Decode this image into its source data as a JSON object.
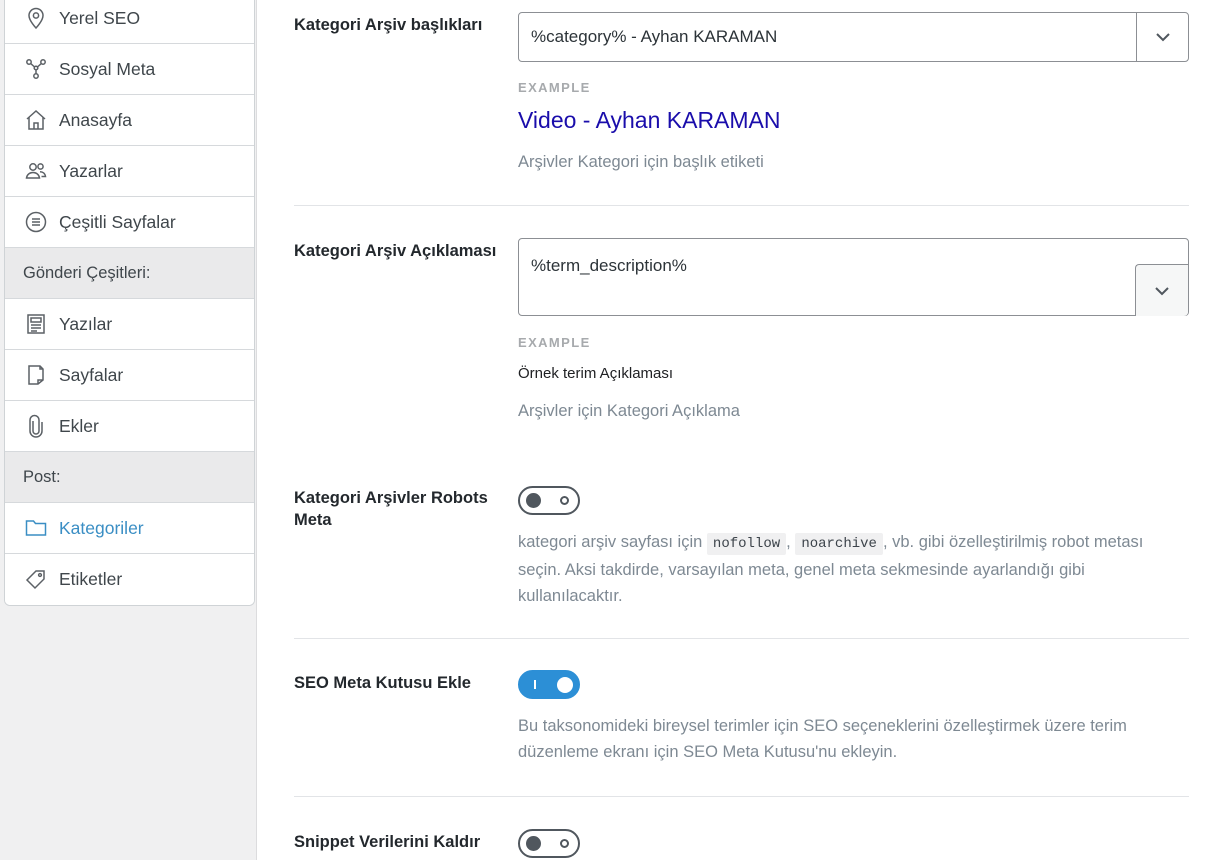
{
  "sidebar": {
    "items": [
      {
        "label": "Yerel SEO",
        "icon": "location-pin-icon"
      },
      {
        "label": "Sosyal Meta",
        "icon": "share-network-icon"
      },
      {
        "label": "Anasayfa",
        "icon": "home-icon"
      },
      {
        "label": "Yazarlar",
        "icon": "users-icon"
      },
      {
        "label": "Çeşitli Sayfalar",
        "icon": "list-circle-icon"
      }
    ],
    "section_post_types": "Gönderi Çeşitleri:",
    "post_type_items": [
      {
        "label": "Yazılar",
        "icon": "document-icon"
      },
      {
        "label": "Sayfalar",
        "icon": "page-icon"
      },
      {
        "label": "Ekler",
        "icon": "paperclip-icon"
      }
    ],
    "section_post": "Post:",
    "post_items": [
      {
        "label": "Kategoriler",
        "icon": "folder-icon",
        "active": true
      },
      {
        "label": "Etiketler",
        "icon": "tag-icon"
      }
    ]
  },
  "settings": {
    "title_row": {
      "label": "Kategori Arşiv başlıkları",
      "value": "%category% - Ayhan KARAMAN",
      "example_label": "EXAMPLE",
      "example_title": "Video - Ayhan KARAMAN",
      "help": "Arşivler Kategori için başlık etiketi"
    },
    "desc_row": {
      "label": "Kategori Arşiv Açıklaması",
      "value": "%term_description%",
      "example_label": "EXAMPLE",
      "example_desc": "Örnek terim Açıklaması",
      "help": "Arşivler için Kategori Açıklama"
    },
    "robots_row": {
      "label": "Kategori Arşivler Robots Meta",
      "enabled": false,
      "help_before": "kategori arşiv sayfası için",
      "code1": "nofollow",
      "sep": ",",
      "code2": "noarchive",
      "help_after": ", vb. gibi özelleştirilmiş robot metası seçin. Aksi takdirde, varsayılan meta, genel meta sekmesinde ayarlandığı gibi kullanılacaktır."
    },
    "metabox_row": {
      "label": "SEO Meta Kutusu Ekle",
      "enabled": true,
      "help": "Bu taksonomideki bireysel terimler için SEO seçeneklerini özelleştirmek üzere terim düzenleme ekranı için SEO Meta Kutusu'nu ekleyin."
    },
    "snippet_row": {
      "label": "Snippet Verilerini Kaldır",
      "enabled": false
    }
  },
  "colors": {
    "accent": "#2c8fd6",
    "link_blue": "#1a0dab",
    "active_sidebar": "#3a8ec4"
  }
}
